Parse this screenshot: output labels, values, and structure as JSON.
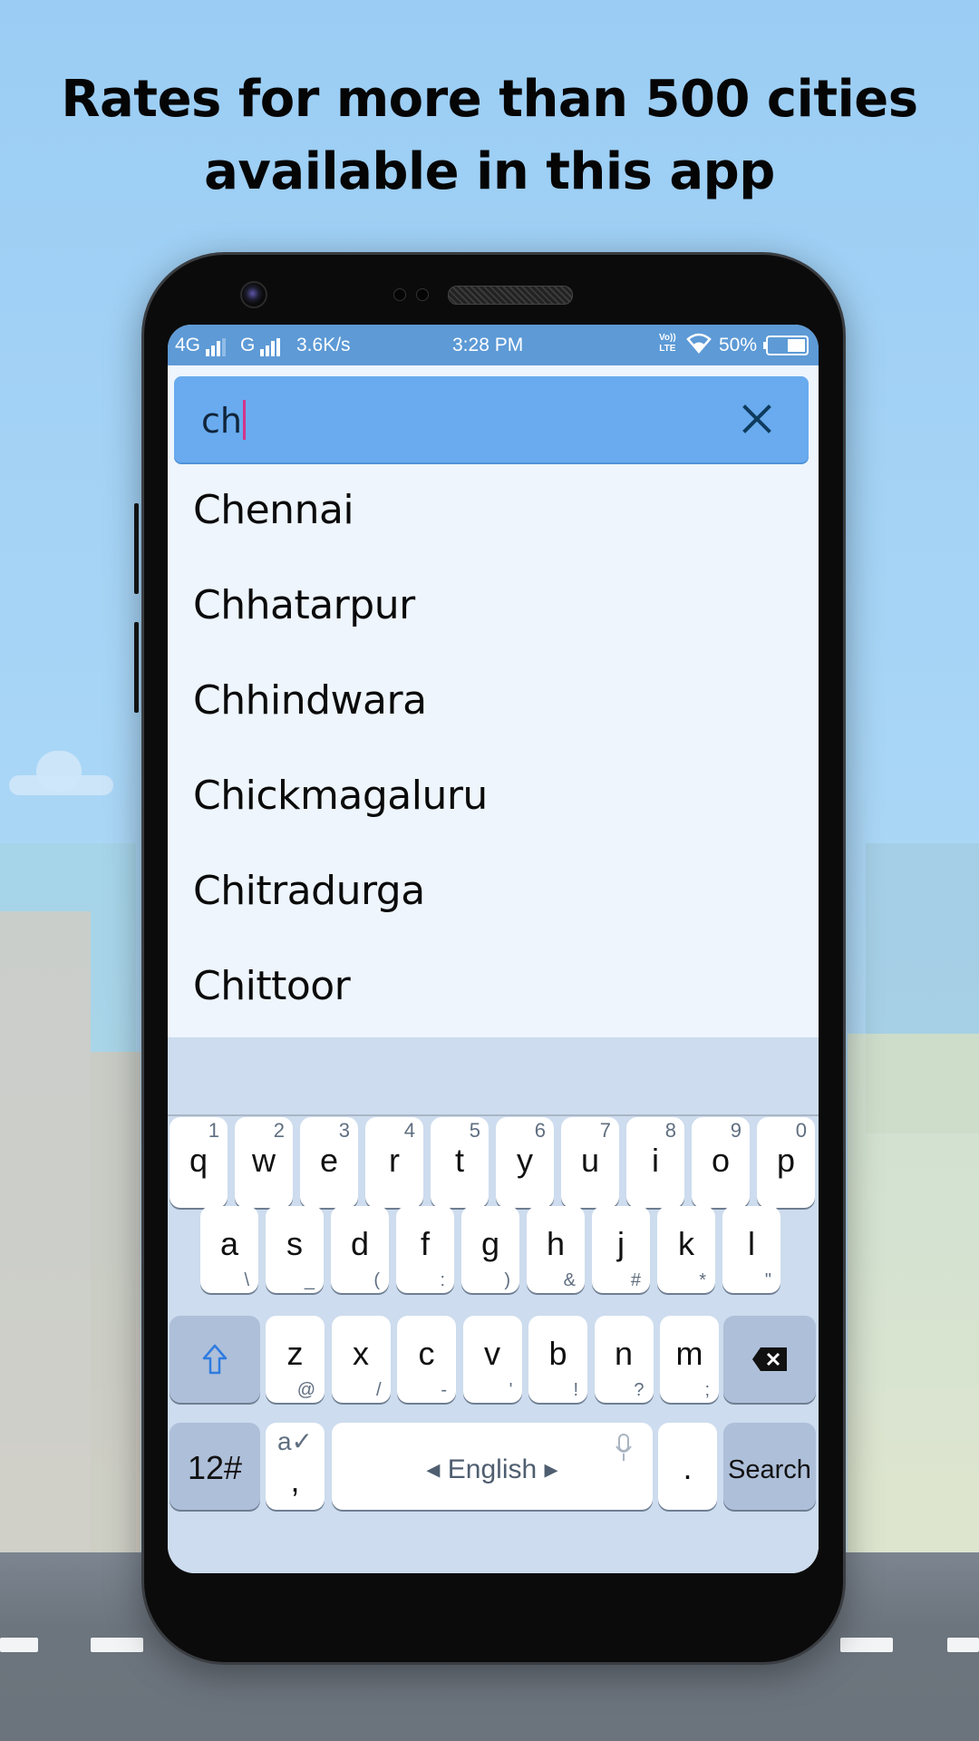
{
  "promo": {
    "title_line1": "Rates for more than 500 cities",
    "title_line2": "available in this app"
  },
  "statusbar": {
    "network1": "4G",
    "network2": "G",
    "speed": "3.6K/s",
    "time": "3:28 PM",
    "volte": "VoLTE",
    "battery": "50%"
  },
  "search": {
    "query": "ch",
    "clear_icon": "close-icon"
  },
  "results": [
    {
      "label": "Chennai"
    },
    {
      "label": "Chhatarpur"
    },
    {
      "label": "Chhindwara"
    },
    {
      "label": "Chickmagaluru"
    },
    {
      "label": "Chitradurga"
    },
    {
      "label": "Chittoor"
    }
  ],
  "keyboard": {
    "row1": [
      {
        "k": "q",
        "n": "1"
      },
      {
        "k": "w",
        "n": "2"
      },
      {
        "k": "e",
        "n": "3"
      },
      {
        "k": "r",
        "n": "4"
      },
      {
        "k": "t",
        "n": "5"
      },
      {
        "k": "y",
        "n": "6"
      },
      {
        "k": "u",
        "n": "7"
      },
      {
        "k": "i",
        "n": "8"
      },
      {
        "k": "o",
        "n": "9"
      },
      {
        "k": "p",
        "n": "0"
      }
    ],
    "row2": [
      {
        "k": "a",
        "s": "\\"
      },
      {
        "k": "s",
        "s": "_"
      },
      {
        "k": "d",
        "s": "("
      },
      {
        "k": "f",
        "s": ":"
      },
      {
        "k": "g",
        "s": ")"
      },
      {
        "k": "h",
        "s": "&"
      },
      {
        "k": "j",
        "s": "#"
      },
      {
        "k": "k",
        "s": "*"
      },
      {
        "k": "l",
        "s": "\""
      }
    ],
    "row3": [
      {
        "k": "z",
        "s": "@"
      },
      {
        "k": "x",
        "s": "/"
      },
      {
        "k": "c",
        "s": "-"
      },
      {
        "k": "v",
        "s": "'"
      },
      {
        "k": "b",
        "s": "!"
      },
      {
        "k": "n",
        "s": "?"
      },
      {
        "k": "m",
        "s": ";"
      }
    ],
    "shift_icon": "shift-arrow-icon",
    "backspace_icon": "backspace-icon",
    "symbols_label": "12#",
    "comma_label": ",",
    "language_label": "English",
    "period_label": ".",
    "search_label": "Search"
  }
}
